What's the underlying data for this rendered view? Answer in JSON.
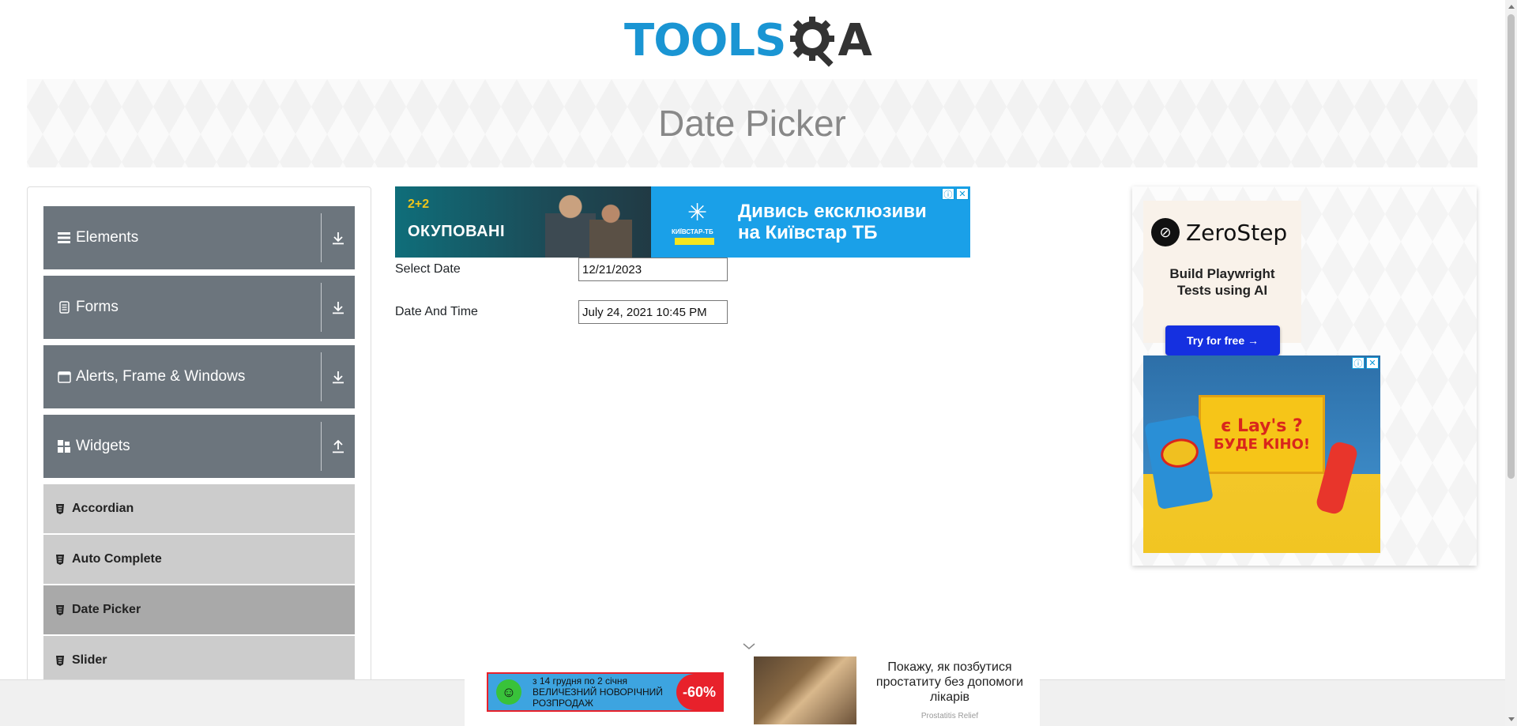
{
  "header": {
    "logo_text": "TOOLS",
    "logo_suffix": "A"
  },
  "banner": {
    "title": "Date Picker"
  },
  "sidebar": {
    "groups": [
      {
        "label": "Elements",
        "icon": "hamburger-icon",
        "expanded": false
      },
      {
        "label": "Forms",
        "icon": "document-icon",
        "expanded": false
      },
      {
        "label": "Alerts, Frame & Windows",
        "icon": "window-icon",
        "expanded": false
      },
      {
        "label": "Widgets",
        "icon": "grid-icon",
        "expanded": true
      }
    ],
    "items": [
      {
        "label": "Accordian",
        "active": false
      },
      {
        "label": "Auto Complete",
        "active": false
      },
      {
        "label": "Date Picker",
        "active": true
      },
      {
        "label": "Slider",
        "active": false
      }
    ]
  },
  "ad_top": {
    "brand": "2+2",
    "show_title": "ОКУПОВАНІ",
    "operator": "КИЇВСТАР-ТБ",
    "message_line1": "Дивись ексклюзиви",
    "message_line2": "на Київстар ТБ"
  },
  "form": {
    "select_date_label": "Select Date",
    "select_date_value": "12/21/2023",
    "date_time_label": "Date And Time",
    "date_time_value": "July 24, 2021 10:45 PM"
  },
  "right_ads": {
    "zerostep_name": "ZeroStep",
    "zerostep_tagline_line1": "Build Playwright",
    "zerostep_tagline_line2": "Tests using AI",
    "zerostep_button": "Try for free →",
    "lays_line1": "є Lay's ?",
    "lays_line2": "БУДЕ КІНО!"
  },
  "bottom_ad": {
    "sale_line1": "з 14 грудня по 2 січня",
    "sale_line2": "ВЕЛИЧЕЗНИЙ НОВОРІЧНИЙ",
    "sale_line3": "РОЗПРОДАЖ",
    "sale_discount": "-60%",
    "text": "Покажу, як позбутися простатиту без допомоги лікарів",
    "source": "Prostatitis Relief"
  },
  "colors": {
    "accent": "#1a95d3",
    "sidebar_group": "#6c757d",
    "sidebar_item": "#cccccc",
    "sidebar_item_active": "#a9a9a9"
  }
}
